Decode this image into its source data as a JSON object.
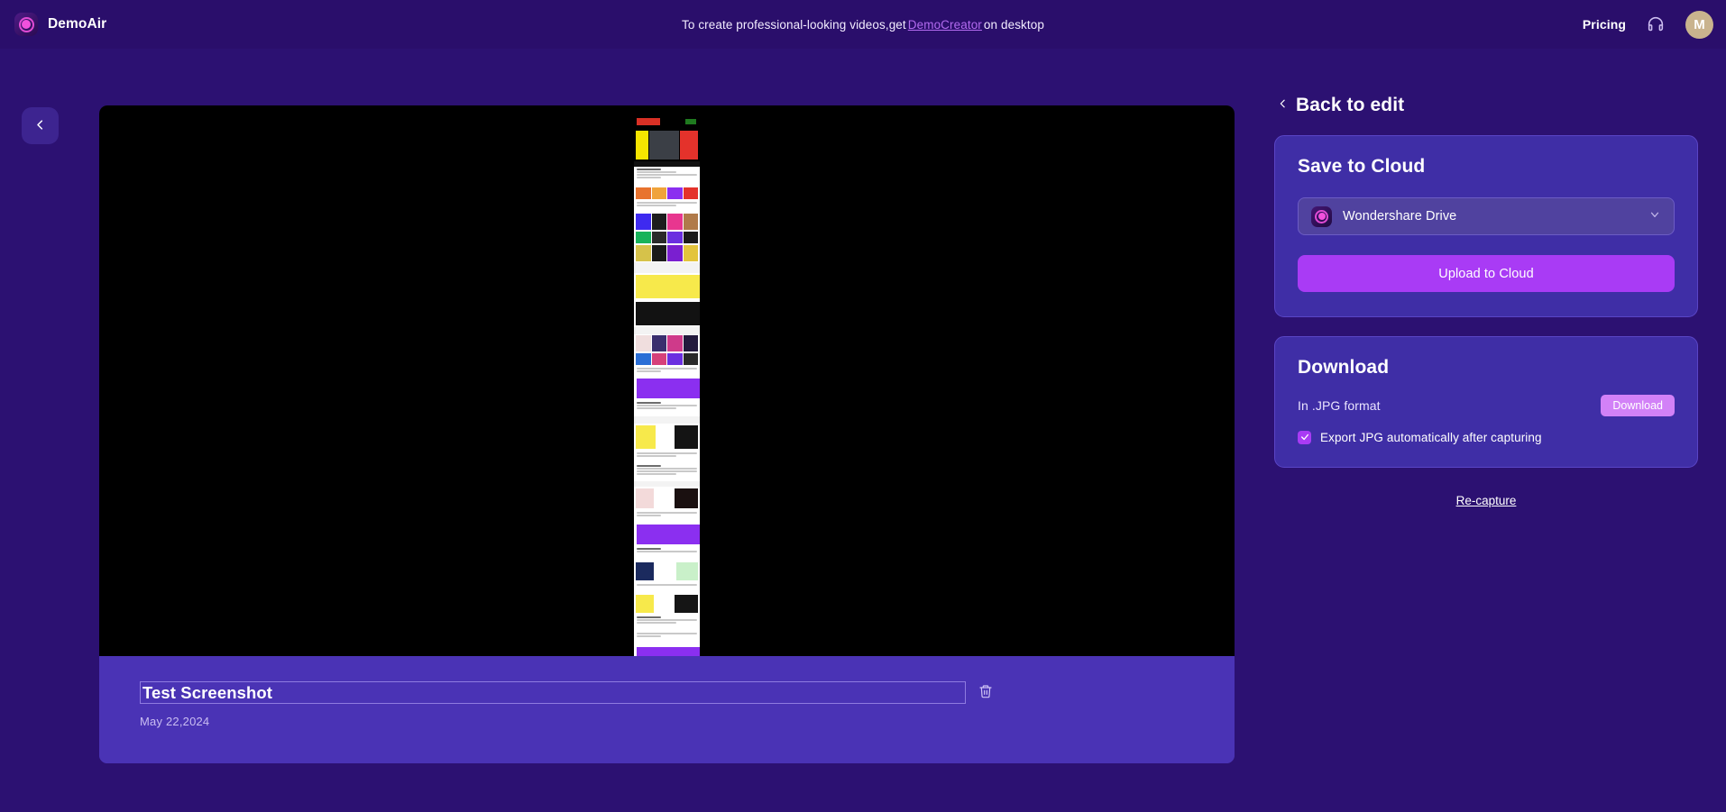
{
  "header": {
    "brand_name": "DemoAir",
    "promo_prefix": "To create professional-looking videos,get",
    "promo_link": "DemoCreator",
    "promo_suffix": "on desktop",
    "pricing_label": "Pricing",
    "support_icon": "headset-icon",
    "avatar_initial": "M",
    "avatar_color": "#c9b38e",
    "background": "#2a0e6b"
  },
  "nav": {
    "back_icon": "chevron-left-icon"
  },
  "preview": {
    "viewer_background": "#000000",
    "caption_background": "#4a33b5",
    "title_value": "Test Screenshot",
    "title_placeholder": "Untitled",
    "date": "May 22,2024",
    "delete_icon": "trash-icon"
  },
  "right_panel": {
    "back_to_edit": "Back to edit",
    "back_icon": "chevron-left-icon",
    "save_card": {
      "title": "Save to Cloud",
      "destination": "Wondershare Drive",
      "destination_icon": "wondershare-drive-icon",
      "dropdown_icon": "chevron-down-icon",
      "upload_label": "Upload to Cloud",
      "upload_color": "#a93bf5"
    },
    "download_card": {
      "title": "Download",
      "format_label": "In .JPG format",
      "download_button": "Download",
      "download_button_color": "#d281f7",
      "checkbox_label": "Export JPG automatically after capturing",
      "checkbox_checked": true,
      "checkbox_icon": "check-icon"
    },
    "recapture_label": "Re-capture"
  },
  "theme": {
    "page_background": "#2c1172",
    "card_background": "#3f2ea6",
    "accent": "#a93bf5",
    "link": "#b36bf0"
  }
}
